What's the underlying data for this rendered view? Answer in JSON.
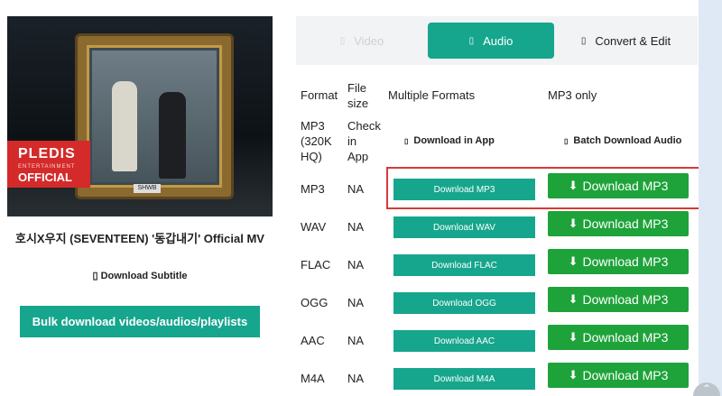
{
  "video": {
    "title": "호시X우지 (SEVENTEEN) '동갑내기' Official MV",
    "thumbnail": {
      "badge_line1": "PLEDIS",
      "badge_line2": "ENTERTAINMENT",
      "badge_line3": "OFFICIAL",
      "tag": "SHWB"
    }
  },
  "actions": {
    "download_subtitle": "Download Subtitle",
    "bulk_download": "Bulk download videos/audios/playlists"
  },
  "tabs": [
    {
      "label": "Video",
      "icon": "video-icon",
      "active": false
    },
    {
      "label": "Audio",
      "icon": "audio-icon",
      "active": true
    },
    {
      "label": "Convert & Edit",
      "icon": "convert-icon",
      "active": false
    }
  ],
  "table": {
    "headers": {
      "format": "Format",
      "filesize_line1": "File",
      "filesize_line2": "size",
      "multiple": "Multiple Formats",
      "mp3only": "MP3 only"
    },
    "first_row": {
      "format_lines": [
        "MP3",
        "(320K",
        "HQ)"
      ],
      "size_lines": [
        "Check",
        "in",
        "App"
      ],
      "app_button": "Download in App",
      "batch_button": "Batch Download Audio"
    },
    "rows": [
      {
        "format": "MP3",
        "size": "NA",
        "button": "Download MP3",
        "mp3_button": "Download MP3"
      },
      {
        "format": "WAV",
        "size": "NA",
        "button": "Download WAV",
        "mp3_button": "Download MP3"
      },
      {
        "format": "FLAC",
        "size": "NA",
        "button": "Download FLAC",
        "mp3_button": "Download MP3"
      },
      {
        "format": "OGG",
        "size": "NA",
        "button": "Download OGG",
        "mp3_button": "Download MP3"
      },
      {
        "format": "AAC",
        "size": "NA",
        "button": "Download AAC",
        "mp3_button": "Download MP3"
      },
      {
        "format": "M4A",
        "size": "NA",
        "button": "Download M4A",
        "mp3_button": "Download MP3"
      }
    ]
  },
  "colors": {
    "accent": "#16a68d",
    "green": "#1ea33a",
    "highlight": "#d63a3a"
  }
}
